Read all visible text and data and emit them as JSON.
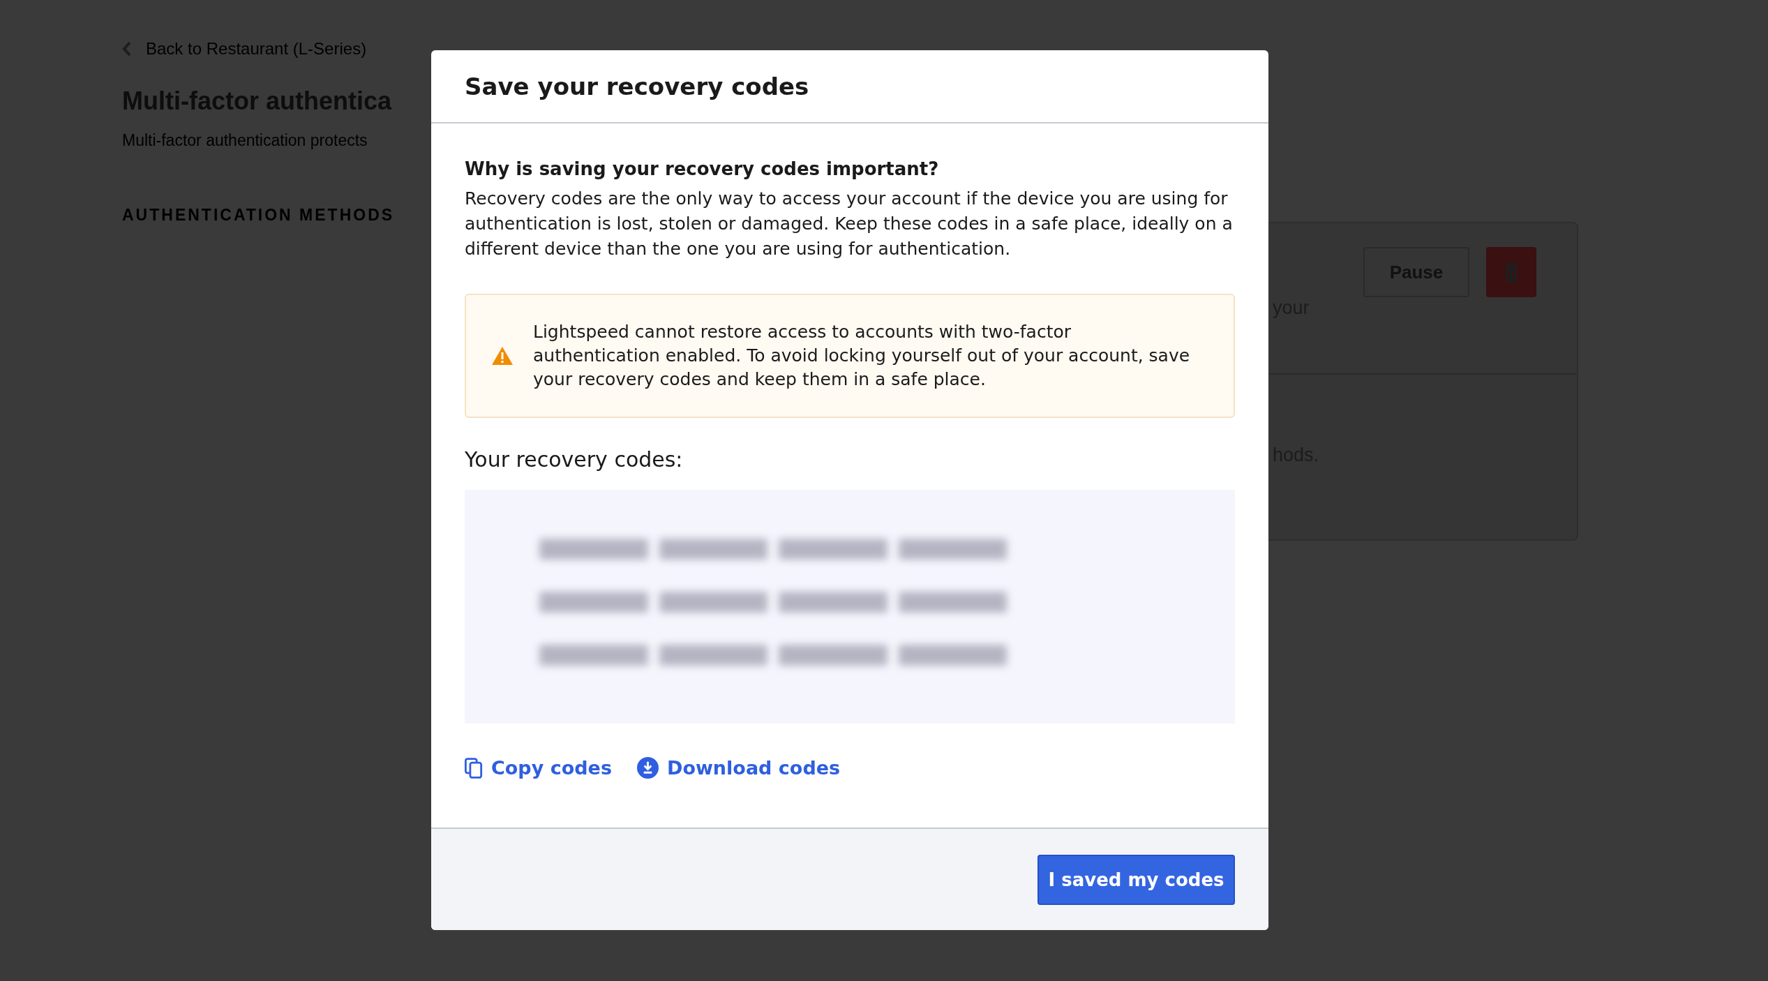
{
  "page": {
    "back_link": "Back to Restaurant (L-Series)",
    "title": "Multi-factor authentica",
    "subtitle": "Multi-factor authentication protects",
    "section_heading": "AUTHENTICATION METHODS",
    "method_card": {
      "row_1_text": "your",
      "pause_button": "Pause",
      "row_2_text": "hods."
    }
  },
  "modal": {
    "title": "Save your recovery codes",
    "question": "Why is saving your recovery codes important?",
    "explanation": "Recovery codes are the only way to access your account if the device you are using for authentication is lost, stolen or damaged. Keep these codes in a safe place, ideally on a different device than the one you are using for authentication.",
    "warning": "Lightspeed cannot restore access to accounts with two-factor authentication enabled. To avoid locking yourself out of your account, save your recovery codes and keep them in a safe place.",
    "codes_label": "Your recovery codes:",
    "actions": [
      {
        "kind": "copy",
        "label": "Copy codes"
      },
      {
        "kind": "download",
        "label": "Download codes"
      }
    ],
    "confirm_button": "I saved my codes"
  }
}
